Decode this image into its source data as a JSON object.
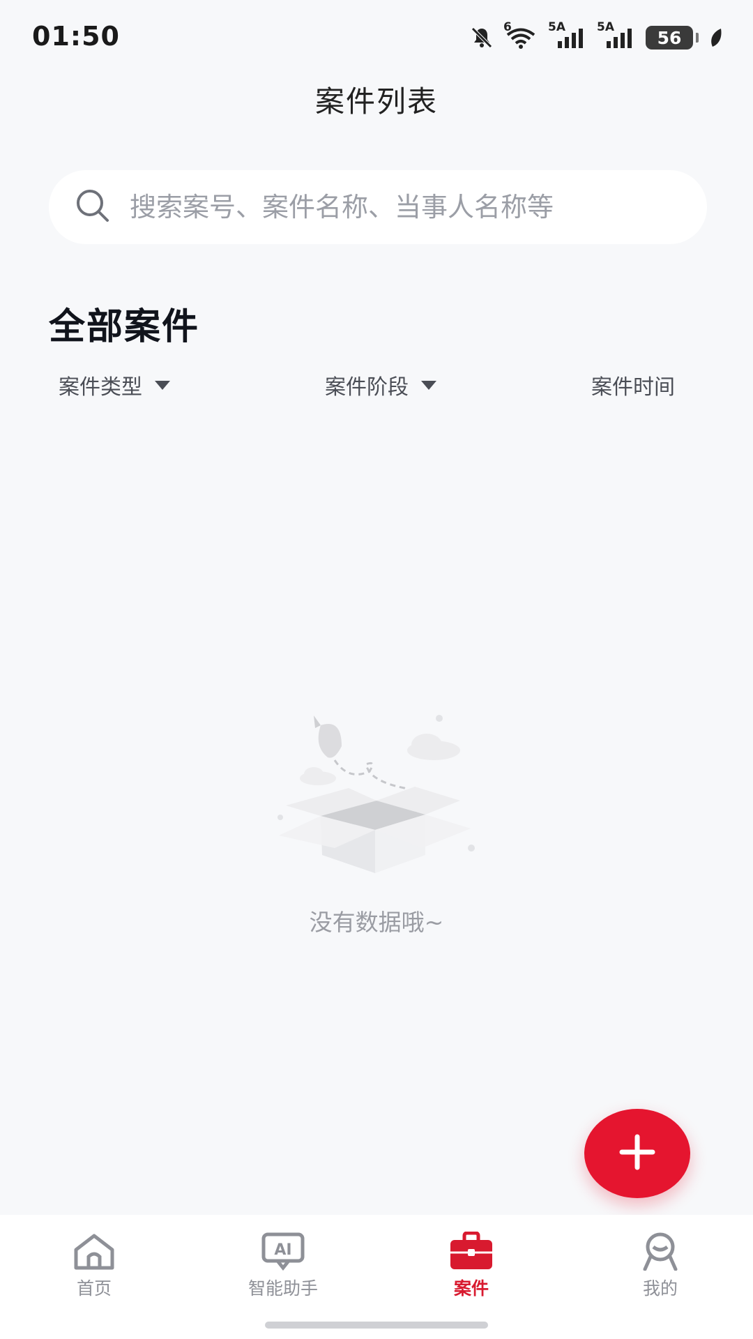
{
  "status_bar": {
    "time": "01:50",
    "battery": "56",
    "net_1": "5A",
    "net_2": "5A",
    "wifi_badge": "6",
    "icons": [
      "bell-off-icon",
      "wifi-icon",
      "signal-icon",
      "signal-icon",
      "battery-icon",
      "leaf-icon"
    ]
  },
  "header": {
    "title": "案件列表"
  },
  "search": {
    "placeholder": "搜索案号、案件名称、当事人名称等",
    "value": ""
  },
  "section": {
    "title": "全部案件"
  },
  "filters": {
    "type_label": "案件类型",
    "stage_label": "案件阶段",
    "time_label": "案件时间"
  },
  "empty_state": {
    "message": "没有数据哦~",
    "icon": "empty-box-illustration"
  },
  "fab": {
    "icon": "plus-icon"
  },
  "bottom_nav": {
    "items": [
      {
        "label": "首页",
        "icon": "home-icon",
        "active": false
      },
      {
        "label": "智能助手",
        "icon": "ai-assistant-icon",
        "active": false
      },
      {
        "label": "案件",
        "icon": "briefcase-icon",
        "active": true
      },
      {
        "label": "我的",
        "icon": "profile-icon",
        "active": false
      }
    ]
  },
  "colors": {
    "accent": "#e5152f",
    "background": "#f7f8fa",
    "nav_inactive": "#8e9097",
    "nav_active": "#d81a2f"
  }
}
